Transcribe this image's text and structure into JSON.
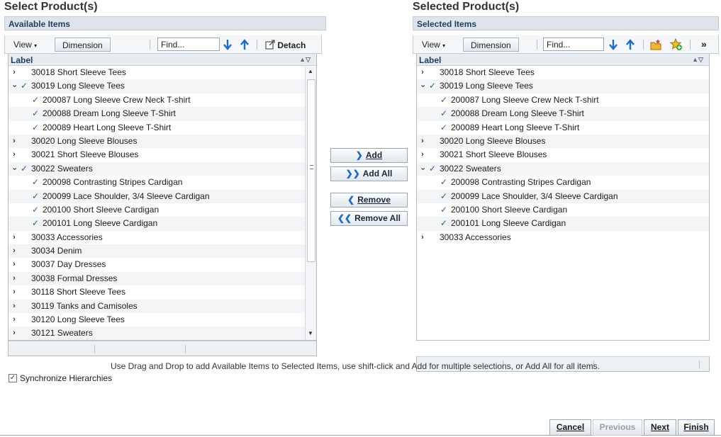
{
  "left": {
    "title": "Select Product(s)",
    "header": "Available Items",
    "toolbar": {
      "view": "View",
      "dimension": "Dimension",
      "find_value": "Find...",
      "detach": "Detach"
    },
    "col_label": "Label",
    "rows": [
      {
        "text": "30018 Short Sleeve Tees",
        "level": 0,
        "expand": "collapsed",
        "checked": false
      },
      {
        "text": "30019 Long Sleeve Tees",
        "level": 0,
        "expand": "expanded",
        "checked": true
      },
      {
        "text": "200087 Long Sleeve Crew Neck T-shirt",
        "level": 1,
        "expand": "none",
        "checked": true
      },
      {
        "text": "200088 Dream Long Sleeve T-Shirt",
        "level": 1,
        "expand": "none",
        "checked": true
      },
      {
        "text": "200089 Heart Long Sleeve T-Shirt",
        "level": 1,
        "expand": "none",
        "checked": true
      },
      {
        "text": "30020 Long Sleeve Blouses",
        "level": 0,
        "expand": "collapsed",
        "checked": false
      },
      {
        "text": "30021 Short Sleeve Blouses",
        "level": 0,
        "expand": "collapsed",
        "checked": false
      },
      {
        "text": "30022 Sweaters",
        "level": 0,
        "expand": "expanded",
        "checked": true
      },
      {
        "text": "200098 Contrasting Stripes Cardigan",
        "level": 1,
        "expand": "none",
        "checked": true
      },
      {
        "text": "200099 Lace Shoulder, 3/4 Sleeve Cardigan",
        "level": 1,
        "expand": "none",
        "checked": true
      },
      {
        "text": "200100 Short Sleeve Cardigan",
        "level": 1,
        "expand": "none",
        "checked": true
      },
      {
        "text": "200101 Long Sleeve Cardigan",
        "level": 1,
        "expand": "none",
        "checked": true
      },
      {
        "text": "30033 Accessories",
        "level": 0,
        "expand": "collapsed",
        "checked": false
      },
      {
        "text": "30034 Denim",
        "level": 0,
        "expand": "collapsed",
        "checked": false
      },
      {
        "text": "30037 Day Dresses",
        "level": 0,
        "expand": "collapsed",
        "checked": false
      },
      {
        "text": "30038 Formal Dresses",
        "level": 0,
        "expand": "collapsed",
        "checked": false
      },
      {
        "text": "30118 Short Sleeve Tees",
        "level": 0,
        "expand": "collapsed",
        "checked": false
      },
      {
        "text": "30119 Tanks and Camisoles",
        "level": 0,
        "expand": "collapsed",
        "checked": false
      },
      {
        "text": "30120 Long Sleeve Tees",
        "level": 0,
        "expand": "collapsed",
        "checked": false
      },
      {
        "text": "30121 Sweaters",
        "level": 0,
        "expand": "collapsed",
        "checked": false
      }
    ]
  },
  "right": {
    "title": "Selected Product(s)",
    "header": "Selected Items",
    "toolbar": {
      "view": "View",
      "dimension": "Dimension",
      "find_value": "Find...",
      "more": "»"
    },
    "col_label": "Label",
    "rows": [
      {
        "text": "30018 Short Sleeve Tees",
        "level": 0,
        "expand": "collapsed",
        "checked": false
      },
      {
        "text": "30019 Long Sleeve Tees",
        "level": 0,
        "expand": "expanded",
        "checked": true
      },
      {
        "text": "200087 Long Sleeve Crew Neck T-shirt",
        "level": 1,
        "expand": "none",
        "checked": true
      },
      {
        "text": "200088 Dream Long Sleeve T-Shirt",
        "level": 1,
        "expand": "none",
        "checked": true
      },
      {
        "text": "200089 Heart Long Sleeve T-Shirt",
        "level": 1,
        "expand": "none",
        "checked": true
      },
      {
        "text": "30020 Long Sleeve Blouses",
        "level": 0,
        "expand": "collapsed",
        "checked": false
      },
      {
        "text": "30021 Short Sleeve Blouses",
        "level": 0,
        "expand": "collapsed",
        "checked": false
      },
      {
        "text": "30022 Sweaters",
        "level": 0,
        "expand": "expanded",
        "checked": true
      },
      {
        "text": "200098 Contrasting Stripes Cardigan",
        "level": 1,
        "expand": "none",
        "checked": true
      },
      {
        "text": "200099 Lace Shoulder, 3/4 Sleeve Cardigan",
        "level": 1,
        "expand": "none",
        "checked": true
      },
      {
        "text": "200100 Short Sleeve Cardigan",
        "level": 1,
        "expand": "none",
        "checked": true
      },
      {
        "text": "200101 Long Sleeve Cardigan",
        "level": 1,
        "expand": "none",
        "checked": true
      },
      {
        "text": "30033 Accessories",
        "level": 0,
        "expand": "collapsed",
        "checked": false
      }
    ]
  },
  "transfer": {
    "add": "Add",
    "add_all": "Add All",
    "remove": "Remove",
    "remove_all": "Remove All"
  },
  "hint": "Use Drag and Drop to add Available Items to Selected Items, use shift-click and Add for multiple selections, or Add All for all items.",
  "sync_label": "Synchronize Hierarchies",
  "sync_checked": true,
  "buttons": {
    "cancel": "Cancel",
    "previous": "Previous",
    "next": "Next",
    "finish": "Finish"
  },
  "colors": {
    "accent": "#1e6bc5",
    "check": "#2a5da0",
    "header_text": "#1f3e5e"
  }
}
